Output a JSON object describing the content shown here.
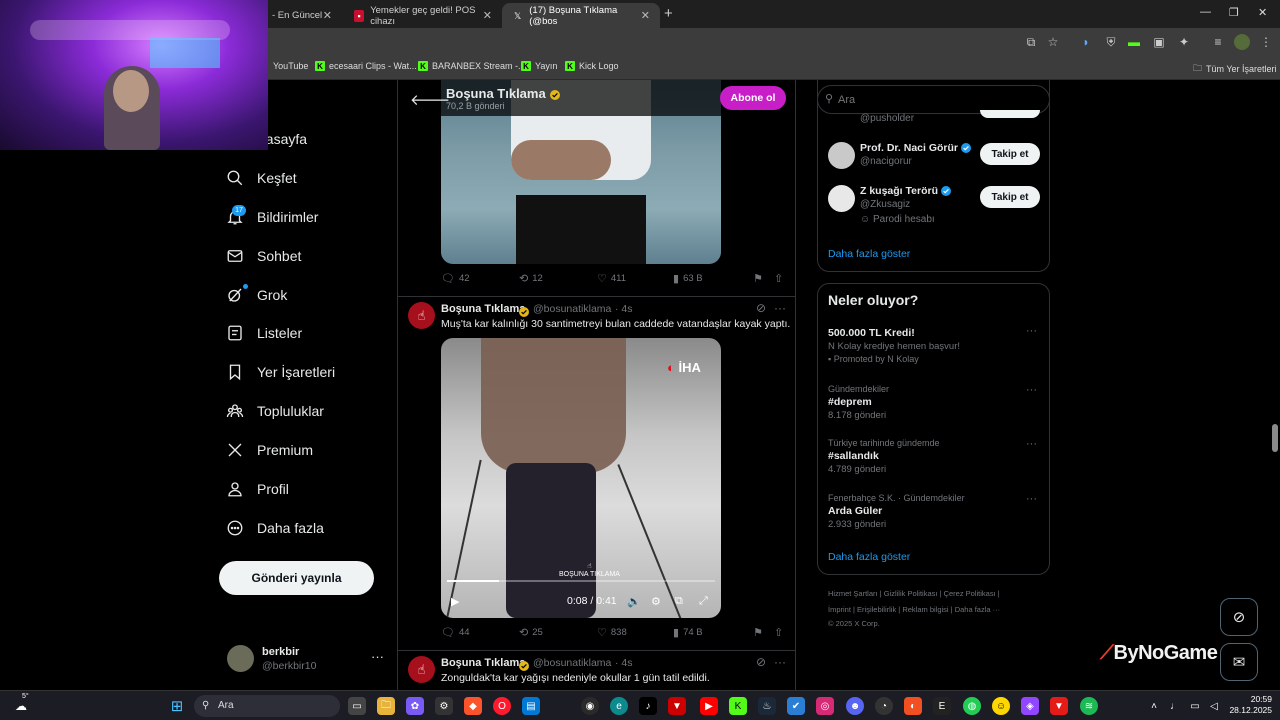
{
  "browser": {
    "tabs": [
      {
        "title": "- En Güncel"
      },
      {
        "title": "Yemekler geç geldi! POS cihazı"
      },
      {
        "title": "(17) Boşuna Tıklama (@bos"
      }
    ],
    "new_tab": "+",
    "bookmarks": [
      {
        "label": "YouTube"
      },
      {
        "label": "ecesaari Clips - Wat..."
      },
      {
        "label": "BARANBEX Stream -..."
      },
      {
        "label": "Yayın"
      },
      {
        "label": "Kick Logo"
      }
    ],
    "all_bookmarks": "Tüm Yer İşaretleri"
  },
  "nav": {
    "items": [
      {
        "label": "nasayfa"
      },
      {
        "label": "Keşfet"
      },
      {
        "label": "Bildirimler"
      },
      {
        "label": "Sohbet"
      },
      {
        "label": "Grok"
      },
      {
        "label": "Listeler"
      },
      {
        "label": "Yer İşaretleri"
      },
      {
        "label": "Topluluklar"
      },
      {
        "label": "Premium"
      },
      {
        "label": "Profil"
      },
      {
        "label": "Daha fazla"
      }
    ],
    "notif_badge": "17",
    "post_button": "Gönderi yayınla",
    "account": {
      "name": "berkbir",
      "handle": "@berkbir10"
    }
  },
  "profile_header": {
    "name": "Boşuna Tıklama",
    "post_count": "70,2 B gönderi",
    "subscribe": "Abone ol"
  },
  "tweets": [
    {
      "actions": {
        "replies": "42",
        "reposts": "12",
        "likes": "411",
        "views": "63 B"
      }
    },
    {
      "name": "Boşuna Tıklama",
      "handle": "@bosunatiklama",
      "time": "· 4s",
      "text": "Muş'ta kar kalınlığı 30 santimetreyi bulan caddede vatandaşlar kayak yaptı.",
      "video": {
        "time": "0:08 / 0:41",
        "progress": 0.195,
        "watermark": "BOŞUNA TIKLAMA",
        "logo": "İHA"
      },
      "actions": {
        "replies": "44",
        "reposts": "25",
        "likes": "838",
        "views": "74 B"
      }
    },
    {
      "name": "Boşuna Tıklama",
      "handle": "@bosunatiklama",
      "time": "· 4s",
      "text": "Zonguldak'ta kar yağışı nedeniyle okullar 1 gün tatil edildi."
    }
  ],
  "search": {
    "placeholder": "Ara"
  },
  "who_to_follow": {
    "partial_handle": "@pusholder",
    "rows": [
      {
        "name": "Prof. Dr. Naci Görür",
        "handle": "@nacigorur",
        "button": "Takip et"
      },
      {
        "name": "Z kuşağı Terörü",
        "handle": "@Zkusagiz",
        "extra": "Parodi hesabı",
        "button": "Takip et"
      }
    ],
    "more": "Daha fazla göster"
  },
  "trends": {
    "title": "Neler oluyor?",
    "items": [
      {
        "context": "",
        "name": "500.000 TL Kredi!",
        "count": "N Kolay krediye hemen başvur!",
        "promo": "Promoted by N Kolay"
      },
      {
        "context": "Gündemdekiler",
        "name": "#deprem",
        "count": "8.178 gönderi"
      },
      {
        "context": "Türkiye tarihinde gündemde",
        "name": "#sallandık",
        "count": "4.789 gönderi"
      },
      {
        "context": "Fenerbahçe S.K. · Gündemdekiler",
        "name": "Arda Güler",
        "count": "2.933 gönderi"
      }
    ],
    "more": "Daha fazla göster"
  },
  "footer": {
    "line1": "Hizmet Şartları  |  Gizlilik Politikası  |  Çerez Politikası  |",
    "line2": "İmprint  |  Erişilebilirlik  |  Reklam bilgisi  |  Daha fazla ···",
    "line3": "© 2025 X Corp."
  },
  "overlay": {
    "brand_a": "By",
    "brand_b": "NoGame"
  },
  "taskbar": {
    "search": "Ara",
    "time": "20:59",
    "date": "28.12.2025",
    "weather": "5°"
  },
  "colors": {
    "accent": "#1d9bf0",
    "subscribe": "#c81ec8",
    "bg": "#000000"
  }
}
